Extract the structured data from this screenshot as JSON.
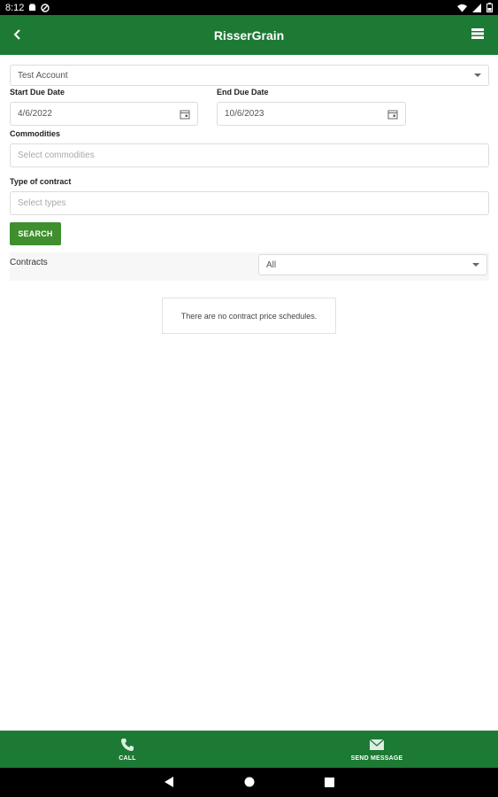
{
  "status_bar": {
    "time": "8:12"
  },
  "app_bar": {
    "title": "RisserGrain"
  },
  "account_select": {
    "value": "Test Account"
  },
  "start_due_date": {
    "label": "Start Due Date",
    "value": "4/6/2022"
  },
  "end_due_date": {
    "label": "End Due Date",
    "value": "10/6/2023"
  },
  "commodities": {
    "label": "Commodities",
    "placeholder": "Select commodities"
  },
  "contract_type": {
    "label": "Type of contract",
    "placeholder": "Select types"
  },
  "search_button": {
    "label": "SEARCH"
  },
  "contracts": {
    "label": "Contracts",
    "filter_value": "All"
  },
  "empty_message": "There are no contract price schedules.",
  "bottom_nav": [
    {
      "label": "CALL",
      "icon": "phone-icon"
    },
    {
      "label": "SEND MESSAGE",
      "icon": "envelope-icon"
    }
  ],
  "colors": {
    "primary": "#1d7a34",
    "button": "#3f8f2e"
  }
}
